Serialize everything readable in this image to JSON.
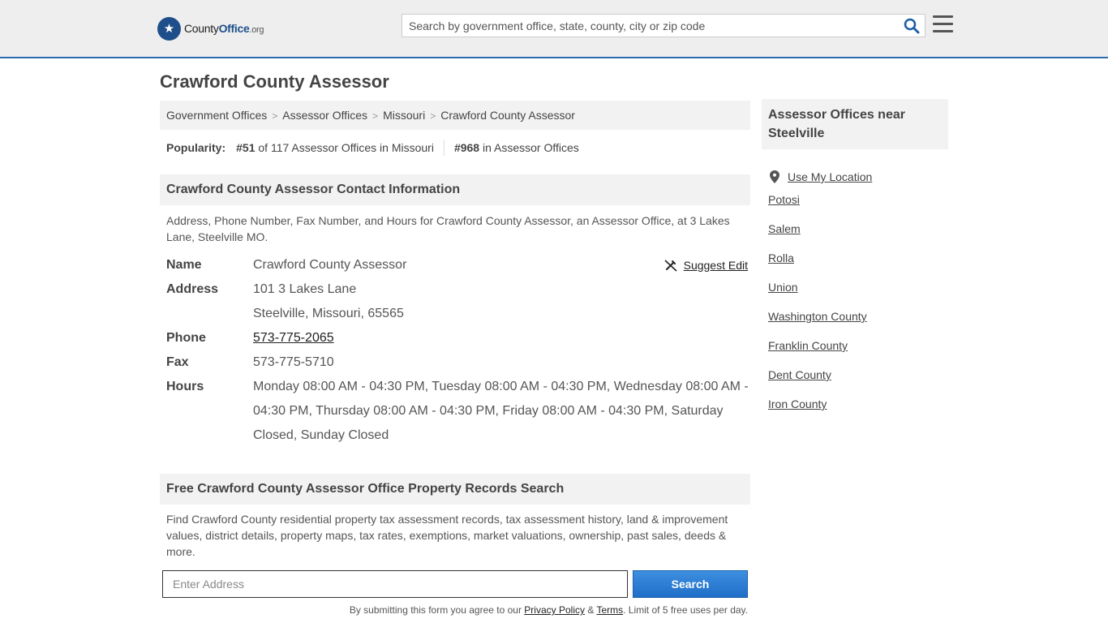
{
  "header": {
    "logo_text_county": "County",
    "logo_text_office": "Office",
    "logo_text_org": ".org",
    "search_placeholder": "Search by government office, state, county, city or zip code"
  },
  "page_title": "Crawford County Assessor",
  "breadcrumb": {
    "items": [
      "Government Offices",
      "Assessor Offices",
      "Missouri",
      "Crawford County Assessor"
    ],
    "separator": ">"
  },
  "popularity": {
    "label": "Popularity:",
    "rank1": "#51",
    "rank1_text": "of 117 Assessor Offices in Missouri",
    "rank2": "#968",
    "rank2_text": "in Assessor Offices"
  },
  "contact": {
    "heading": "Crawford County Assessor Contact Information",
    "description": "Address, Phone Number, Fax Number, and Hours for Crawford County Assessor, an Assessor Office, at 3 Lakes Lane, Steelville MO.",
    "suggest_edit": "Suggest Edit",
    "name_label": "Name",
    "name": "Crawford County Assessor",
    "address_label": "Address",
    "address_line1": "101 3 Lakes Lane",
    "address_line2": "Steelville, Missouri, 65565",
    "phone_label": "Phone",
    "phone": "573-775-2065",
    "fax_label": "Fax",
    "fax": "573-775-5710",
    "hours_label": "Hours",
    "hours": "Monday 08:00 AM - 04:30 PM, Tuesday 08:00 AM - 04:30 PM, Wednesday 08:00 AM - 04:30 PM, Thursday 08:00 AM - 04:30 PM, Friday 08:00 AM - 04:30 PM, Saturday Closed, Sunday Closed"
  },
  "records": {
    "heading": "Free Crawford County Assessor Office Property Records Search",
    "description": "Find Crawford County residential property tax assessment records, tax assessment history, land & improvement values, district details, property maps, tax rates, exemptions, market valuations, ownership, past sales, deeds & more.",
    "address_placeholder": "Enter Address",
    "search_button": "Search",
    "disclaimer_pre": "By submitting this form you agree to our",
    "privacy_link": "Privacy Policy",
    "amp": "&",
    "terms_link": "Terms",
    "disclaimer_post": ". Limit of 5 free uses per day."
  },
  "sidebar": {
    "heading": "Assessor Offices near Steelville",
    "use_location": "Use My Location",
    "links": [
      "Potosi",
      "Salem",
      "Rolla",
      "Union",
      "Washington County",
      "Franklin County",
      "Dent County",
      "Iron County"
    ]
  },
  "colors": {
    "accent": "#2b6cb0",
    "button": "#1f6fc8",
    "section_bg": "#f2f2f2",
    "header_bg": "#eeeeee"
  }
}
